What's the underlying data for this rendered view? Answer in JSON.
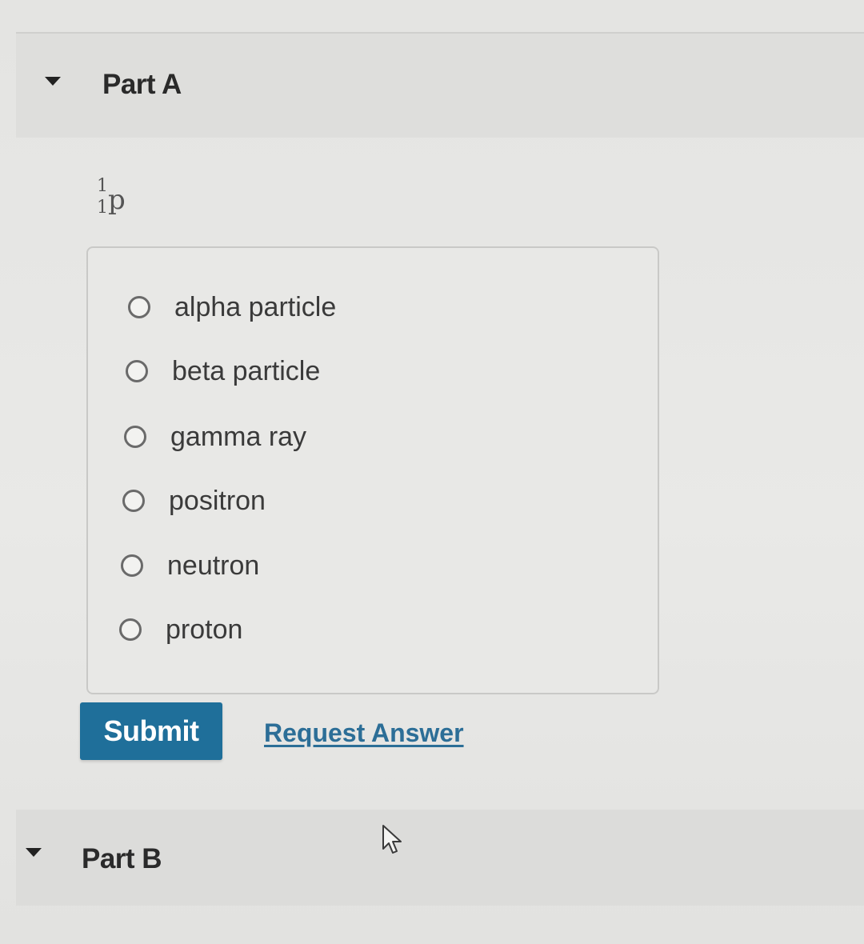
{
  "part_a": {
    "title": "Part A",
    "isotope": {
      "mass_number": "1",
      "atomic_number": "1",
      "symbol": "p"
    },
    "options": [
      {
        "label": "alpha particle",
        "selected": false
      },
      {
        "label": "beta particle",
        "selected": false
      },
      {
        "label": "gamma ray",
        "selected": false
      },
      {
        "label": "positron",
        "selected": false
      },
      {
        "label": "neutron",
        "selected": false
      },
      {
        "label": "proton",
        "selected": false
      }
    ],
    "submit_label": "Submit",
    "request_answer_label": "Request Answer"
  },
  "part_b": {
    "title": "Part B"
  },
  "icons": {
    "expand_caret": "caret-down-icon",
    "radio": "radio-unchecked-icon",
    "pointer": "mouse-pointer-icon"
  },
  "colors": {
    "submit_background": "#1f6f9a",
    "link": "#2c6e97"
  }
}
